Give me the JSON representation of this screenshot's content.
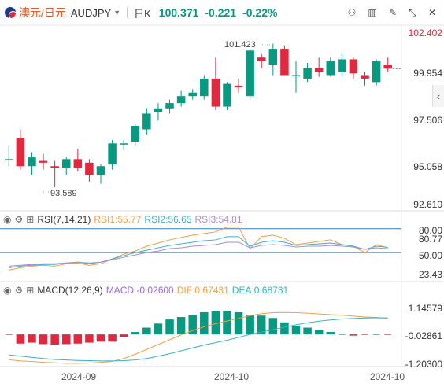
{
  "header": {
    "flag_icon": "flag-icon",
    "symbol_cn": "澳元/日元",
    "symbol": "AUDJPY",
    "dropdown_icon": "caret-down-icon",
    "timeframe": "日K",
    "timeframe_icon": "chart-icon",
    "last_price": "100.371",
    "change": "-0.221",
    "change_pct": "-0.22%",
    "toolbar_icons": [
      "indicator-icon",
      "bar-chart-icon",
      "draw-icon",
      "settings-icon",
      "collapse-icon",
      "close-icon"
    ]
  },
  "main_pane": {
    "y_ticks": [
      "102.402",
      "99.954",
      "97.506",
      "95.058",
      "92.610"
    ],
    "high_label": "101.423",
    "low_label": "93.589"
  },
  "rsi_pane": {
    "name": "RSI(7,14,21)",
    "rsi1": "RSI1:55.77",
    "rsi2": "RSI2:56.65",
    "rsi3": "RSI3:54.81",
    "y_ticks": [
      "80.00",
      "80.77",
      "50.00",
      "23.43"
    ],
    "colors": {
      "rsi1": "#f59e42",
      "rsi2": "#36b3c9",
      "rsi3": "#a98bd9"
    }
  },
  "macd_pane": {
    "name": "MACD(12,26,9)",
    "macd": "MACD:-0.02600",
    "dif": "DIF:0.67431",
    "dea": "DEA:0.68731",
    "y_ticks": [
      "1.14579",
      "-0.02861",
      "-1.20300"
    ],
    "colors": {
      "macd": "#9b6bd6",
      "dif": "#f59e42",
      "dea": "#36b3c9"
    }
  },
  "x_axis": [
    "2024-09",
    "2024-10",
    "2024-10"
  ],
  "chart_data": [
    {
      "type": "candlestick",
      "title": "澳元/日元 AUDJPY 日K",
      "ylim": [
        92.61,
        102.402
      ],
      "candles": [
        {
          "o": 95.2,
          "h": 96.0,
          "l": 94.8,
          "c": 95.2
        },
        {
          "o": 96.4,
          "h": 96.9,
          "l": 94.6,
          "c": 94.8
        },
        {
          "o": 94.8,
          "h": 95.6,
          "l": 94.3,
          "c": 95.3
        },
        {
          "o": 95.1,
          "h": 95.5,
          "l": 94.6,
          "c": 95.0
        },
        {
          "o": 94.8,
          "h": 95.1,
          "l": 93.6,
          "c": 94.7
        },
        {
          "o": 94.7,
          "h": 95.3,
          "l": 94.3,
          "c": 95.2
        },
        {
          "o": 95.2,
          "h": 95.8,
          "l": 94.5,
          "c": 94.7
        },
        {
          "o": 95.0,
          "h": 95.2,
          "l": 93.9,
          "c": 94.3
        },
        {
          "o": 94.3,
          "h": 94.9,
          "l": 93.8,
          "c": 94.8
        },
        {
          "o": 94.9,
          "h": 96.3,
          "l": 94.6,
          "c": 96.1
        },
        {
          "o": 96.1,
          "h": 96.3,
          "l": 95.7,
          "c": 96.1
        },
        {
          "o": 96.2,
          "h": 97.2,
          "l": 96.0,
          "c": 97.1
        },
        {
          "o": 96.9,
          "h": 98.1,
          "l": 96.6,
          "c": 97.8
        },
        {
          "o": 97.9,
          "h": 98.4,
          "l": 97.4,
          "c": 98.1
        },
        {
          "o": 98.1,
          "h": 98.6,
          "l": 97.8,
          "c": 98.4
        },
        {
          "o": 98.4,
          "h": 99.1,
          "l": 98.2,
          "c": 98.8
        },
        {
          "o": 98.8,
          "h": 99.2,
          "l": 98.6,
          "c": 99.0
        },
        {
          "o": 98.8,
          "h": 100.0,
          "l": 98.6,
          "c": 99.8
        },
        {
          "o": 99.8,
          "h": 101.0,
          "l": 98.0,
          "c": 98.2
        },
        {
          "o": 98.2,
          "h": 99.6,
          "l": 98.0,
          "c": 99.5
        },
        {
          "o": 99.4,
          "h": 99.8,
          "l": 99.0,
          "c": 99.3
        },
        {
          "o": 98.8,
          "h": 101.5,
          "l": 98.6,
          "c": 101.4
        },
        {
          "o": 101.0,
          "h": 101.2,
          "l": 100.4,
          "c": 100.8
        },
        {
          "o": 100.6,
          "h": 101.8,
          "l": 100.0,
          "c": 101.5
        },
        {
          "o": 101.5,
          "h": 101.7,
          "l": 100.0,
          "c": 100.0
        },
        {
          "o": 100.0,
          "h": 100.8,
          "l": 99.0,
          "c": 100.0
        },
        {
          "o": 99.8,
          "h": 100.7,
          "l": 99.6,
          "c": 100.4
        },
        {
          "o": 100.4,
          "h": 101.0,
          "l": 99.9,
          "c": 100.2
        },
        {
          "o": 100.0,
          "h": 101.0,
          "l": 99.9,
          "c": 100.8
        },
        {
          "o": 100.2,
          "h": 101.2,
          "l": 99.9,
          "c": 100.9
        },
        {
          "o": 100.9,
          "h": 101.0,
          "l": 99.8,
          "c": 100.1
        },
        {
          "o": 100.0,
          "h": 100.2,
          "l": 99.4,
          "c": 99.8
        },
        {
          "o": 99.6,
          "h": 100.9,
          "l": 99.4,
          "c": 100.8
        },
        {
          "o": 100.6,
          "h": 101.0,
          "l": 100.2,
          "c": 100.37
        }
      ]
    },
    {
      "type": "line",
      "title": "RSI(7,14,21)",
      "ylim": [
        23.43,
        80.77
      ],
      "series": [
        {
          "name": "RSI1",
          "values": [
            28,
            31,
            33,
            34,
            33,
            36,
            37,
            34,
            36,
            42,
            48,
            52,
            58,
            62,
            66,
            69,
            72,
            74,
            76,
            82,
            82,
            55,
            70,
            72,
            68,
            60,
            62,
            64,
            66,
            60,
            58,
            50,
            60,
            55.77
          ]
        },
        {
          "name": "RSI2",
          "values": [
            31,
            33,
            34,
            35,
            35,
            37,
            38,
            36,
            38,
            42,
            46,
            50,
            53,
            56,
            59,
            61,
            63,
            65,
            66,
            70,
            70,
            58,
            63,
            65,
            63,
            59,
            60,
            61,
            62,
            60,
            58,
            54,
            58,
            56.65
          ]
        },
        {
          "name": "RSI3",
          "values": [
            33,
            34,
            35,
            36,
            36,
            37,
            38,
            37,
            38,
            41,
            44,
            47,
            50,
            52,
            55,
            56,
            58,
            59,
            60,
            63,
            63,
            56,
            59,
            60,
            59,
            57,
            58,
            58,
            59,
            58,
            57,
            54,
            56,
            54.81
          ]
        }
      ]
    },
    {
      "type": "bar",
      "title": "MACD(12,26,9)",
      "ylim": [
        -1.203,
        1.14579
      ],
      "series": [
        {
          "name": "MACD",
          "values": [
            -0.04,
            -0.38,
            -0.34,
            -0.4,
            -0.42,
            -0.4,
            -0.38,
            -0.34,
            -0.3,
            -0.3,
            -0.1,
            0.1,
            0.28,
            0.45,
            0.62,
            0.72,
            0.8,
            0.92,
            0.95,
            0.95,
            0.92,
            0.8,
            0.78,
            0.68,
            0.5,
            0.36,
            0.28,
            0.2,
            0.1,
            0.02,
            -0.05,
            -0.02,
            0.0,
            -0.026
          ]
        },
        {
          "name": "DIF",
          "values": [
            -1.05,
            -1.1,
            -1.12,
            -1.16,
            -1.18,
            -1.2,
            -1.2,
            -1.19,
            -1.16,
            -1.12,
            -1.0,
            -0.82,
            -0.62,
            -0.42,
            -0.22,
            -0.02,
            0.16,
            0.32,
            0.44,
            0.56,
            0.66,
            0.78,
            0.86,
            0.9,
            0.91,
            0.9,
            0.88,
            0.85,
            0.82,
            0.8,
            0.76,
            0.72,
            0.7,
            0.674
          ]
        },
        {
          "name": "DEA",
          "values": [
            -0.85,
            -0.9,
            -0.95,
            -1.0,
            -1.04,
            -1.06,
            -1.08,
            -1.09,
            -1.1,
            -1.1,
            -1.09,
            -1.06,
            -1.0,
            -0.9,
            -0.8,
            -0.68,
            -0.56,
            -0.44,
            -0.34,
            -0.24,
            -0.12,
            0.0,
            0.1,
            0.2,
            0.3,
            0.4,
            0.48,
            0.55,
            0.6,
            0.64,
            0.66,
            0.68,
            0.69,
            0.687
          ]
        }
      ]
    }
  ]
}
